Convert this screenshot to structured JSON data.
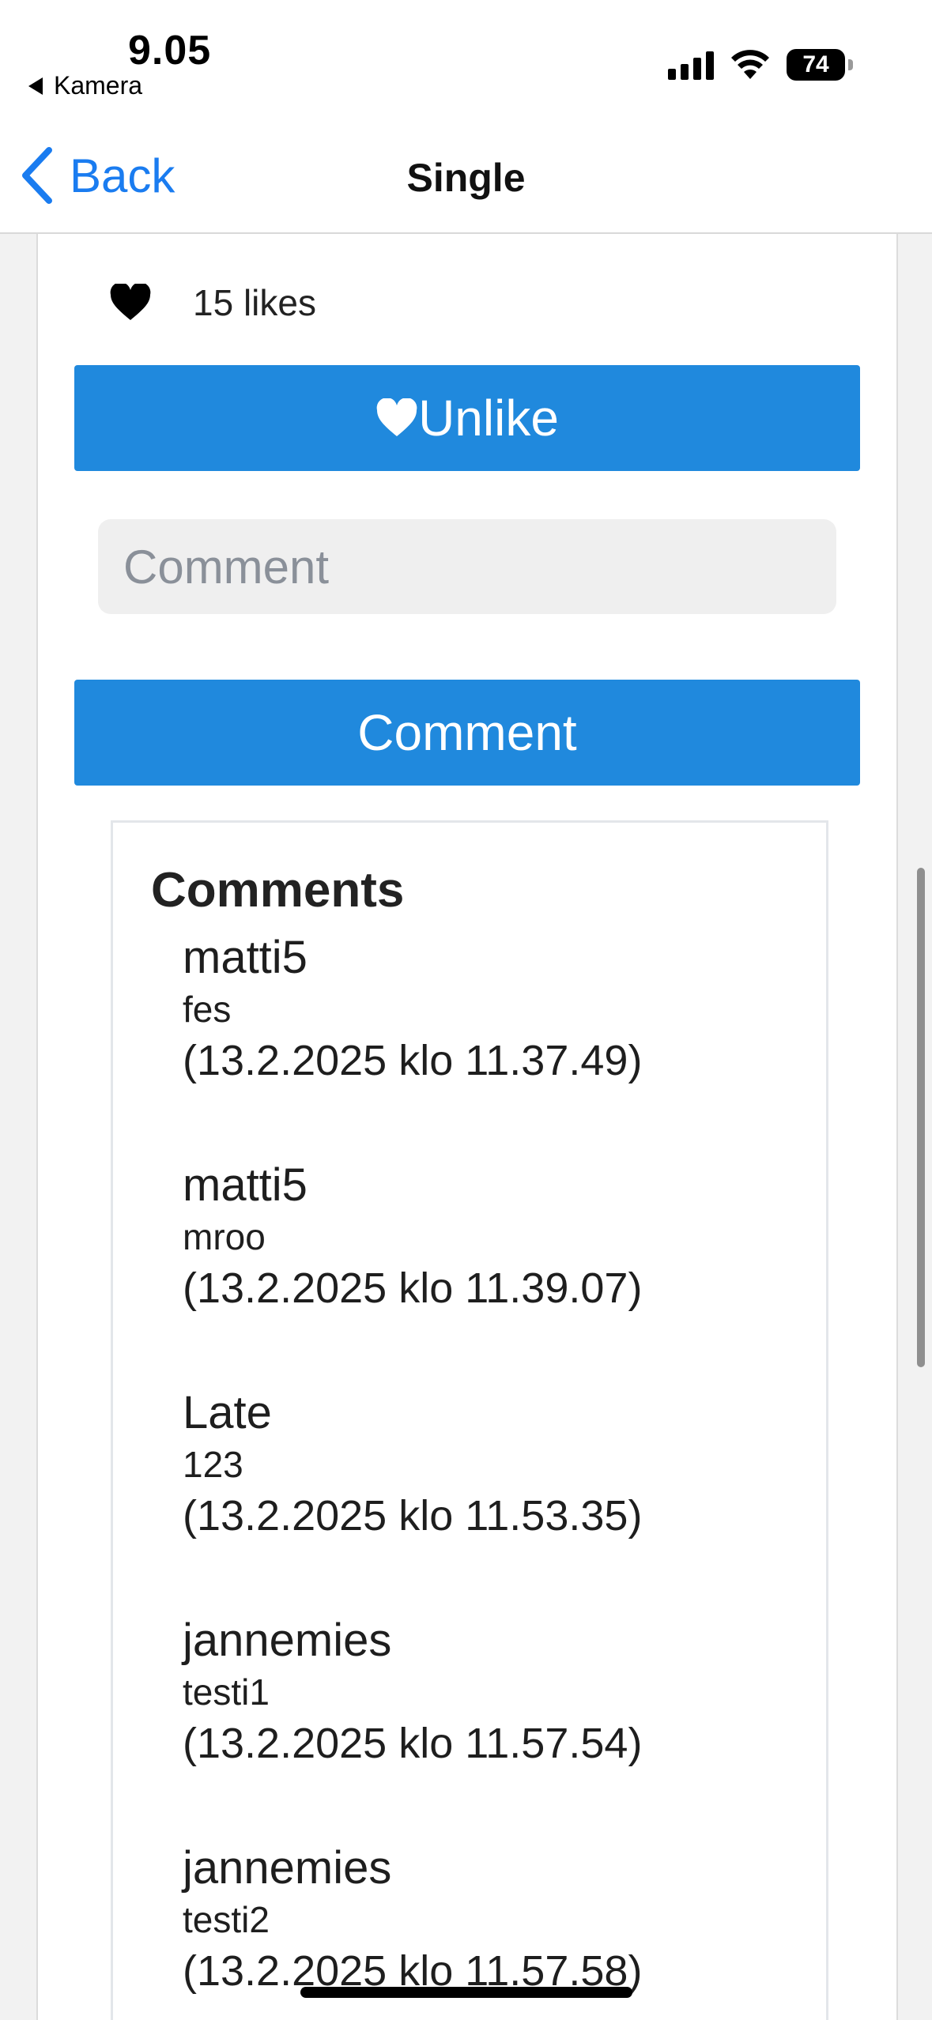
{
  "status_bar": {
    "time": "9.05",
    "back_app": "Kamera",
    "battery": "74"
  },
  "nav": {
    "back_label": "Back",
    "title": "Single"
  },
  "post": {
    "likes_text": "15 likes",
    "unlike_label": "Unlike",
    "comment_placeholder": "Comment",
    "comment_button_label": "Comment"
  },
  "comments": {
    "title": "Comments",
    "items": [
      {
        "user": "matti5",
        "text": "fes",
        "date": "(13.2.2025 klo 11.37.49)"
      },
      {
        "user": "matti5",
        "text": "mroo",
        "date": "(13.2.2025 klo 11.39.07)"
      },
      {
        "user": "Late",
        "text": "123",
        "date": "(13.2.2025 klo 11.53.35)"
      },
      {
        "user": "jannemies",
        "text": "testi1",
        "date": "(13.2.2025 klo 11.57.54)"
      },
      {
        "user": "jannemies",
        "text": "testi2",
        "date": "(13.2.2025 klo 11.57.58)"
      }
    ]
  },
  "colors": {
    "accent": "#1a7cf0",
    "button": "#2089dd"
  }
}
